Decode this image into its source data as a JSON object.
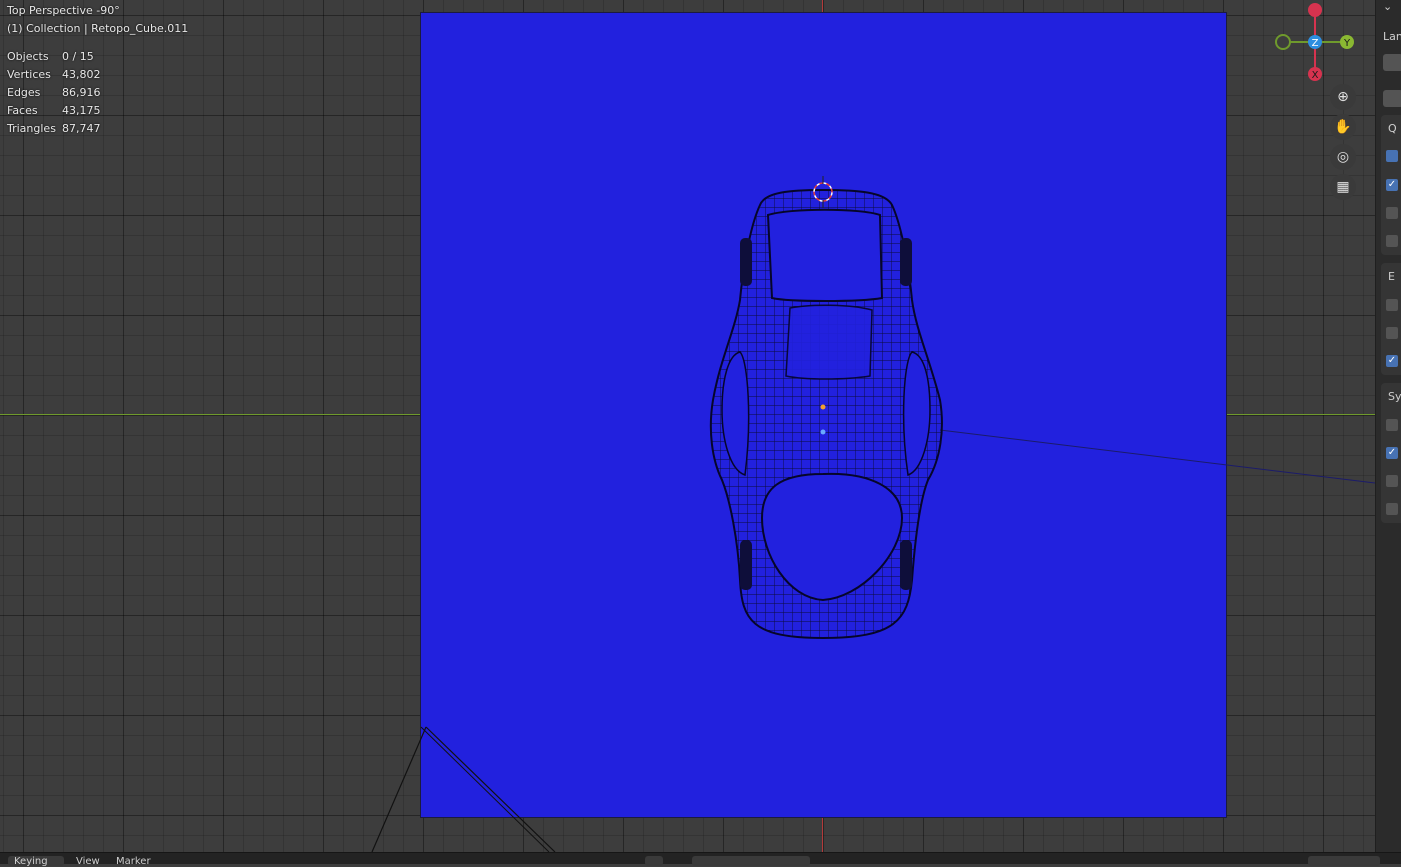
{
  "viewport": {
    "view_name": "Top Perspective -90°",
    "collection": "(1) Collection | Retopo_Cube.011"
  },
  "stats": [
    {
      "label": "Objects",
      "value": "0 / 15"
    },
    {
      "label": "Vertices",
      "value": "43,802"
    },
    {
      "label": "Edges",
      "value": "86,916"
    },
    {
      "label": "Faces",
      "value": "43,175"
    },
    {
      "label": "Triangles",
      "value": "87,747"
    }
  ],
  "gizmo": {
    "x_label": "X",
    "y_label": "Y",
    "z_label": "Z"
  },
  "colors": {
    "reference_plane": "#2221de",
    "axis_x": "#d6334f",
    "axis_y": "#6f9a2c",
    "axis_z": "#2d8ee0",
    "checkbox_on": "#4772b3"
  },
  "nav_icons": [
    "zoom-icon",
    "pan-hand-icon",
    "camera-icon",
    "grid-toggle-icon"
  ],
  "n_panel": {
    "labels": [
      "Lan",
      "Q",
      "E",
      "Sy"
    ]
  },
  "timeline": {
    "playback_label": "Keying",
    "view_label": "View",
    "marker_label": "Marker"
  }
}
